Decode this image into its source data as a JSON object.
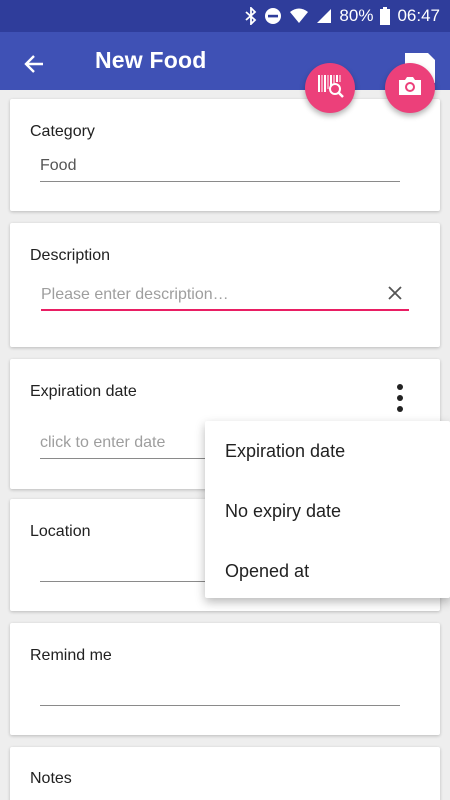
{
  "status_bar": {
    "battery": "80%",
    "time": "06:47",
    "icons": [
      "bluetooth-icon",
      "do-not-disturb-icon",
      "wifi-icon",
      "signal-icon",
      "battery-icon"
    ]
  },
  "app_bar": {
    "title": "New Food",
    "back_icon": "back-arrow-icon",
    "save_icon": "save-icon",
    "color": "#3f51b5"
  },
  "fabs": {
    "barcode_icon": "barcode-search-icon",
    "camera_icon": "camera-icon",
    "color": "#ec407a"
  },
  "cards": {
    "category": {
      "label": "Category",
      "value": "Food"
    },
    "description": {
      "label": "Description",
      "placeholder": "Please enter description…",
      "accent": "#e91e63"
    },
    "expiration": {
      "label": "Expiration date",
      "placeholder": "click to enter date"
    },
    "location": {
      "label": "Location",
      "value": ""
    },
    "remind": {
      "label": "Remind me",
      "value": ""
    },
    "notes": {
      "label": "Notes"
    }
  },
  "menu": {
    "items": [
      {
        "label": "Expiration date"
      },
      {
        "label": "No expiry date"
      },
      {
        "label": "Opened at"
      }
    ]
  }
}
